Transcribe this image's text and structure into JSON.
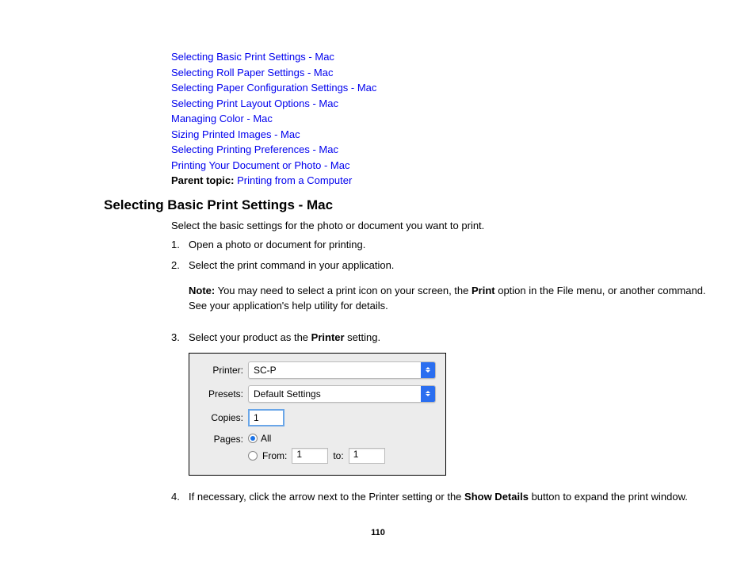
{
  "links": [
    "Selecting Basic Print Settings - Mac",
    "Selecting Roll Paper Settings - Mac",
    "Selecting Paper Configuration Settings - Mac",
    "Selecting Print Layout Options - Mac",
    "Managing Color - Mac",
    "Sizing Printed Images - Mac",
    "Selecting Printing Preferences - Mac",
    "Printing Your Document or Photo - Mac"
  ],
  "parent_topic": {
    "label": "Parent topic:",
    "link": "Printing from a Computer"
  },
  "heading": "Selecting Basic Print Settings - Mac",
  "intro": "Select the basic settings for the photo or document you want to print.",
  "steps": {
    "s1": {
      "num": "1.",
      "text": "Open a photo or document for printing."
    },
    "s2": {
      "num": "2.",
      "text": "Select the print command in your application."
    },
    "note": {
      "label": "Note:",
      "t1": " You may need to select a print icon on your screen, the ",
      "bold": "Print",
      "t2": " option in the File menu, or another command. See your application's help utility for details."
    },
    "s3": {
      "num": "3.",
      "t1": "Select your product as the ",
      "bold": "Printer",
      "t2": " setting."
    },
    "s4": {
      "num": "4.",
      "t1": "If necessary, click the arrow next to the Printer setting or the ",
      "bold": "Show Details",
      "t2": " button to expand the print window."
    }
  },
  "dialog": {
    "printer_label": "Printer:",
    "printer_value": "SC-P",
    "presets_label": "Presets:",
    "presets_value": "Default Settings",
    "copies_label": "Copies:",
    "copies_value": "1",
    "pages_label": "Pages:",
    "all_label": "All",
    "from_label": "From:",
    "from_value": "1",
    "to_label": "to:",
    "to_value": "1"
  },
  "page_number": "110"
}
